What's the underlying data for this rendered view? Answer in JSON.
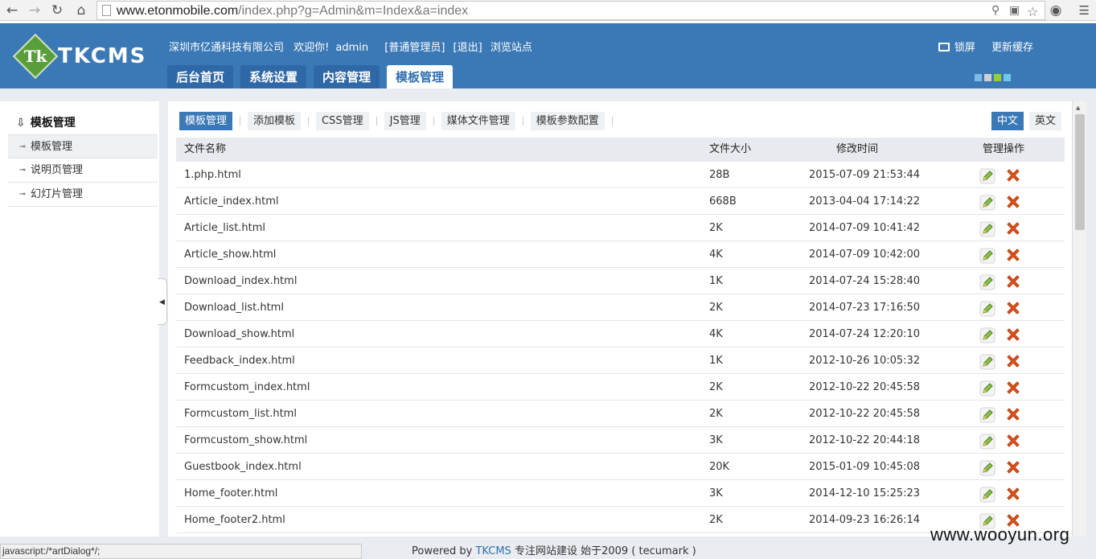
{
  "browser": {
    "url_host": "www.etonmobile.com",
    "url_path": "/index.php?g=Admin&m=Index&a=index"
  },
  "header": {
    "logo_text": "TKCMS",
    "logo_mark": "Tk",
    "company": "深圳市亿通科技有限公司",
    "welcome": "欢迎你!",
    "user": "admin",
    "role": "[普通管理员]",
    "logout": "[退出]",
    "view_site": "浏览站点",
    "lock": "锁屏",
    "clear_cache": "更新缓存",
    "tabs": [
      "后台首页",
      "系统设置",
      "内容管理",
      "模板管理"
    ],
    "skin_colors": [
      "#7fbde8",
      "#d0d0d0",
      "#9acd32",
      "#6fc9e6"
    ]
  },
  "sidebar": {
    "title": "模板管理",
    "items": [
      "模板管理",
      "说明页管理",
      "幻灯片管理"
    ]
  },
  "subtabs": [
    "模板管理",
    "添加模板",
    "CSS管理",
    "JS管理",
    "媒体文件管理",
    "模板参数配置"
  ],
  "lang": {
    "cn": "中文",
    "en": "英文"
  },
  "table": {
    "headers": [
      "文件名称",
      "文件大小",
      "修改时间",
      "管理操作"
    ],
    "rows": [
      [
        "1.php.html",
        "28B",
        "2015-07-09 21:53:44"
      ],
      [
        "Article_index.html",
        "668B",
        "2013-04-04 17:14:22"
      ],
      [
        "Article_list.html",
        "2K",
        "2014-07-09 10:41:42"
      ],
      [
        "Article_show.html",
        "4K",
        "2014-07-09 10:42:00"
      ],
      [
        "Download_index.html",
        "1K",
        "2014-07-24 15:28:40"
      ],
      [
        "Download_list.html",
        "2K",
        "2014-07-23 17:16:50"
      ],
      [
        "Download_show.html",
        "4K",
        "2014-07-24 12:20:10"
      ],
      [
        "Feedback_index.html",
        "1K",
        "2012-10-26 10:05:32"
      ],
      [
        "Formcustom_index.html",
        "2K",
        "2012-10-22 20:45:58"
      ],
      [
        "Formcustom_list.html",
        "2K",
        "2012-10-22 20:45:58"
      ],
      [
        "Formcustom_show.html",
        "3K",
        "2012-10-22 20:44:18"
      ],
      [
        "Guestbook_index.html",
        "20K",
        "2015-01-09 10:45:08"
      ],
      [
        "Home_footer.html",
        "3K",
        "2014-12-10 15:25:23"
      ],
      [
        "Home_footer2.html",
        "2K",
        "2014-09-23 16:26:14"
      ]
    ]
  },
  "footer": {
    "powered_by": "Powered by",
    "brand": "TKCMS",
    "tagline": "专注网站建设  始于2009 ( tecumark )"
  },
  "status_text": "javascript:/*artDialog*/;",
  "watermark": "www.wooyun.org"
}
